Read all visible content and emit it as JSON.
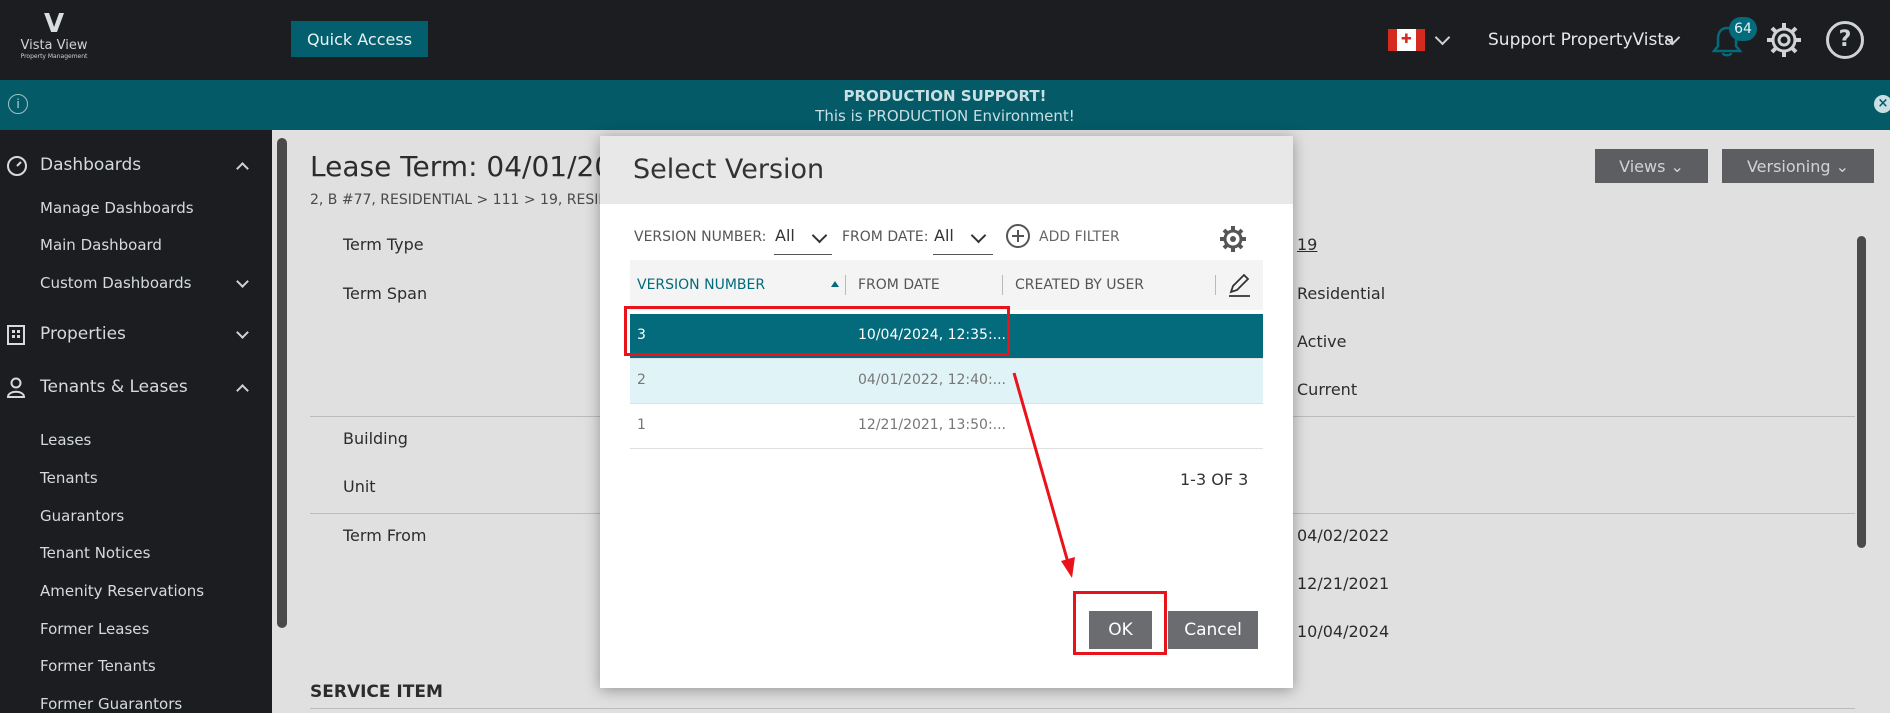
{
  "brand": {
    "mark": "V",
    "name": "Vista View",
    "sub": "Property Management"
  },
  "topbar": {
    "quick_access": "Quick Access",
    "user": "Support PropertyVista",
    "notifications": "64"
  },
  "notice": {
    "title": "PRODUCTION SUPPORT!",
    "text": "This is PRODUCTION Environment!",
    "info": "i",
    "close": "×"
  },
  "sidebar": {
    "dashboards": "Dashboards",
    "dash_items": [
      "Manage Dashboards",
      "Main Dashboard",
      "Custom Dashboards"
    ],
    "properties": "Properties",
    "tenants_leases": "Tenants & Leases",
    "tl_items": [
      "Leases",
      "Tenants",
      "Guarantors",
      "Tenant Notices",
      "Amenity Reservations",
      "Former Leases",
      "Former Tenants",
      "Former Guarantors"
    ]
  },
  "main": {
    "title": "Lease Term: 04/01/202",
    "breadcrumb": "2, B #77, RESIDENTIAL > 111 > 19, RESIDE",
    "views": "Views",
    "versioning": "Versioning",
    "labels": [
      "Term Type",
      "Term Span",
      "Building",
      "Unit",
      "Term From"
    ],
    "right_values": [
      "19",
      "Residential",
      "Active",
      "Current",
      "04/02/2022",
      "12/21/2021",
      "10/04/2024"
    ],
    "service_item": "SERVICE ITEM"
  },
  "dialog": {
    "title": "Select Version",
    "filter_version_label": "VERSION NUMBER:",
    "filter_version_value": "All",
    "filter_date_label": "FROM DATE:",
    "filter_date_value": "All",
    "add_filter": "ADD FILTER",
    "columns": [
      "VERSION NUMBER",
      "FROM DATE",
      "CREATED BY USER"
    ],
    "rows": [
      {
        "version": "3",
        "from_date": "10/04/2024, 12:35:..."
      },
      {
        "version": "2",
        "from_date": "04/01/2022, 12:40:..."
      },
      {
        "version": "1",
        "from_date": "12/21/2021, 13:50:..."
      }
    ],
    "pager": "1-3 OF 3",
    "ok": "OK",
    "cancel": "Cancel"
  },
  "colors": {
    "topbar": "#1b1d20",
    "accent": "#036b7c",
    "notice": "#045a67",
    "annotation": "#e8131b"
  }
}
